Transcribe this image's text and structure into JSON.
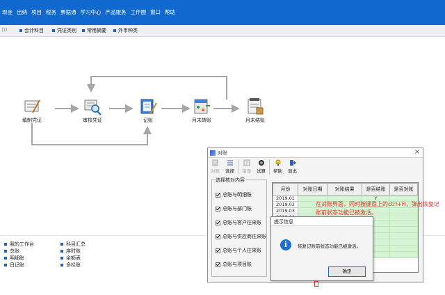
{
  "menu": [
    "现金",
    "出纳",
    "项目",
    "税务",
    "票据通",
    "学习中心",
    "产品服务",
    "工作圈",
    "窗口",
    "帮助"
  ],
  "toolbar": {
    "grip": ")))",
    "items": [
      "会计科目",
      "凭证类别",
      "常用摘要",
      "外币种类"
    ]
  },
  "flow": {
    "nodes": [
      "填制凭证",
      "审核凭证",
      "记账",
      "月末转账",
      "月末结账"
    ]
  },
  "bottom_links": {
    "col1": [
      "我的工作台",
      "总账",
      "明细账",
      "日记账"
    ],
    "col2": [
      "科目汇总",
      "序时账",
      "余额表",
      "多栏账"
    ]
  },
  "reconcile_dialog": {
    "title": "对账",
    "close": "×",
    "tools": [
      {
        "label": "对账",
        "icon": "reconcile-icon",
        "enabled": false
      },
      {
        "label": "选择",
        "icon": "select-icon",
        "enabled": true
      },
      {
        "label": "错误",
        "icon": "error-icon",
        "enabled": false
      },
      {
        "label": "试算",
        "icon": "trial-balance-icon",
        "enabled": true
      },
      {
        "label": "帮助",
        "icon": "help-icon",
        "enabled": true
      },
      {
        "label": "退出",
        "icon": "exit-icon",
        "enabled": true
      }
    ],
    "group_label": "选择核对内容",
    "checks": [
      "总账与明细账",
      "总账与部门账",
      "总账与客户往来账",
      "总账与供应商往来账",
      "总账与个人往来账",
      "总账与项目账"
    ],
    "columns": [
      "月份",
      "对账日期",
      "对账结果",
      "是否结账",
      "是否对账"
    ],
    "rows": [
      {
        "month": "2019.01",
        "closed": "Y"
      },
      {
        "month": "2019.02",
        "closed": ""
      },
      {
        "month": "2019.03",
        "closed": ""
      },
      {
        "month": "2019.04",
        "closed": ""
      }
    ]
  },
  "annotation": "在对账界面，同时按键盘上的ctrl+H，弹出恢复记账前状态功能已被激活。",
  "message_dialog": {
    "title": "提示信息",
    "text": "恢复记账前状态功能已被激活。",
    "ok": "确定"
  }
}
